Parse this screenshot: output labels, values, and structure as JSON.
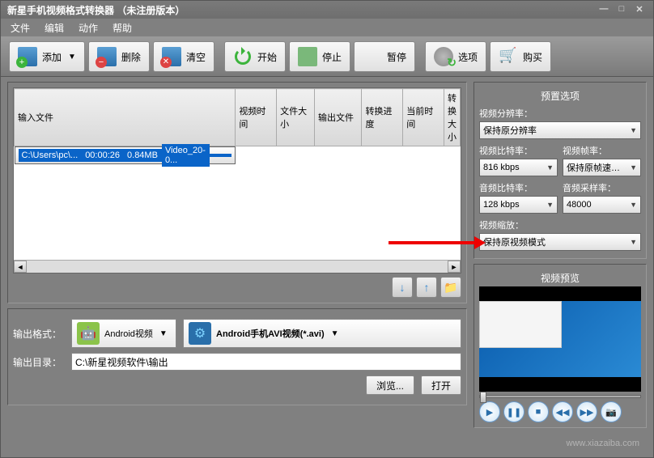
{
  "title": "新星手机视频格式转换器 （未注册版本）",
  "menu": {
    "file": "文件",
    "edit": "编辑",
    "action": "动作",
    "help": "帮助"
  },
  "toolbar": {
    "add": "添加",
    "del": "删除",
    "clear": "清空",
    "start": "开始",
    "stop": "停止",
    "pause": "暂停",
    "options": "选项",
    "buy": "购买"
  },
  "table": {
    "headers": {
      "input": "输入文件",
      "vtime": "视频时间",
      "fsize": "文件大小",
      "output": "输出文件",
      "progress": "转换进度",
      "curtime": "当前时间",
      "convsize": "转换大小"
    },
    "rows": [
      {
        "input": "C:\\Users\\pc\\...",
        "vtime": "00:00:26",
        "fsize": "0.84MB",
        "output": "Video_20-0...",
        "progress": "",
        "curtime": "",
        "convsize": ""
      }
    ]
  },
  "listbtns": {
    "down": "↓",
    "up": "↑",
    "folder": "📁"
  },
  "output": {
    "format_label": "输出格式：",
    "category": "Android视频",
    "profile": "Android手机AVI视频(*.avi)",
    "dir_label": "输出目录：",
    "dir_value": "C:\\新星视频软件\\输出",
    "browse": "浏览...",
    "open": "打开"
  },
  "preset": {
    "title": "预置选项",
    "res_label": "视频分辨率：",
    "res_value": "保持原分辨率",
    "vbit_label": "视频比特率：",
    "vbit_value": "816 kbps",
    "vfps_label": "视频帧率：",
    "vfps_value": "保持原帧速…",
    "abit_label": "音频比特率：",
    "abit_value": "128 kbps",
    "asamp_label": "音频采样率：",
    "asamp_value": "48000",
    "scale_label": "视频缩放：",
    "scale_value": "保持原视频模式"
  },
  "preview": {
    "title": "视频预览"
  },
  "watermark": "www.xiazaiba.com"
}
